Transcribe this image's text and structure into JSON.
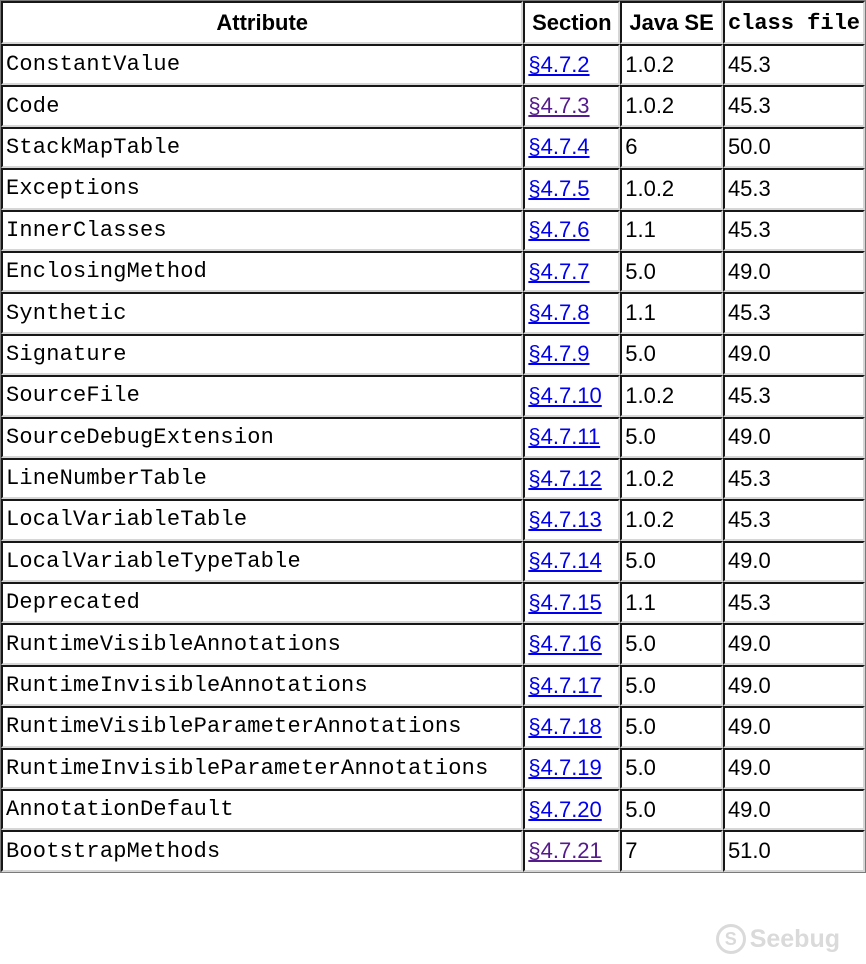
{
  "table": {
    "headers": {
      "attribute": "Attribute",
      "section": "Section",
      "java_se": "Java SE",
      "class_file": "class file"
    },
    "rows": [
      {
        "attribute": "ConstantValue",
        "section": "§4.7.2",
        "section_visited": false,
        "java_se": "1.0.2",
        "class_file": "45.3"
      },
      {
        "attribute": "Code",
        "section": "§4.7.3",
        "section_visited": true,
        "java_se": "1.0.2",
        "class_file": "45.3"
      },
      {
        "attribute": "StackMapTable",
        "section": "§4.7.4",
        "section_visited": false,
        "java_se": "6",
        "class_file": "50.0"
      },
      {
        "attribute": "Exceptions",
        "section": "§4.7.5",
        "section_visited": false,
        "java_se": "1.0.2",
        "class_file": "45.3"
      },
      {
        "attribute": "InnerClasses",
        "section": "§4.7.6",
        "section_visited": false,
        "java_se": "1.1",
        "class_file": "45.3"
      },
      {
        "attribute": "EnclosingMethod",
        "section": "§4.7.7",
        "section_visited": false,
        "java_se": "5.0",
        "class_file": "49.0"
      },
      {
        "attribute": "Synthetic",
        "section": "§4.7.8",
        "section_visited": false,
        "java_se": "1.1",
        "class_file": "45.3"
      },
      {
        "attribute": "Signature",
        "section": "§4.7.9",
        "section_visited": false,
        "java_se": "5.0",
        "class_file": "49.0"
      },
      {
        "attribute": "SourceFile",
        "section": "§4.7.10",
        "section_visited": false,
        "java_se": "1.0.2",
        "class_file": "45.3"
      },
      {
        "attribute": "SourceDebugExtension",
        "section": "§4.7.11",
        "section_visited": false,
        "java_se": "5.0",
        "class_file": "49.0"
      },
      {
        "attribute": "LineNumberTable",
        "section": "§4.7.12",
        "section_visited": false,
        "java_se": "1.0.2",
        "class_file": "45.3"
      },
      {
        "attribute": "LocalVariableTable",
        "section": "§4.7.13",
        "section_visited": false,
        "java_se": "1.0.2",
        "class_file": "45.3"
      },
      {
        "attribute": "LocalVariableTypeTable",
        "section": "§4.7.14",
        "section_visited": false,
        "java_se": "5.0",
        "class_file": "49.0"
      },
      {
        "attribute": "Deprecated",
        "section": "§4.7.15",
        "section_visited": false,
        "java_se": "1.1",
        "class_file": "45.3"
      },
      {
        "attribute": "RuntimeVisibleAnnotations",
        "section": "§4.7.16",
        "section_visited": false,
        "java_se": "5.0",
        "class_file": "49.0"
      },
      {
        "attribute": "RuntimeInvisibleAnnotations",
        "section": "§4.7.17",
        "section_visited": false,
        "java_se": "5.0",
        "class_file": "49.0"
      },
      {
        "attribute": "RuntimeVisibleParameterAnnotations",
        "section": "§4.7.18",
        "section_visited": false,
        "java_se": "5.0",
        "class_file": "49.0"
      },
      {
        "attribute": "RuntimeInvisibleParameterAnnotations",
        "section": "§4.7.19",
        "section_visited": false,
        "java_se": "5.0",
        "class_file": "49.0"
      },
      {
        "attribute": "AnnotationDefault",
        "section": "§4.7.20",
        "section_visited": false,
        "java_se": "5.0",
        "class_file": "49.0"
      },
      {
        "attribute": "BootstrapMethods",
        "section": "§4.7.21",
        "section_visited": true,
        "java_se": "7",
        "class_file": "51.0"
      }
    ]
  },
  "colors": {
    "link": "#0000ee",
    "link_visited": "#551a8b",
    "watermark": "#d4d4d4"
  },
  "watermark": {
    "text": "Seebug",
    "icon": "seebug-logo-icon"
  }
}
